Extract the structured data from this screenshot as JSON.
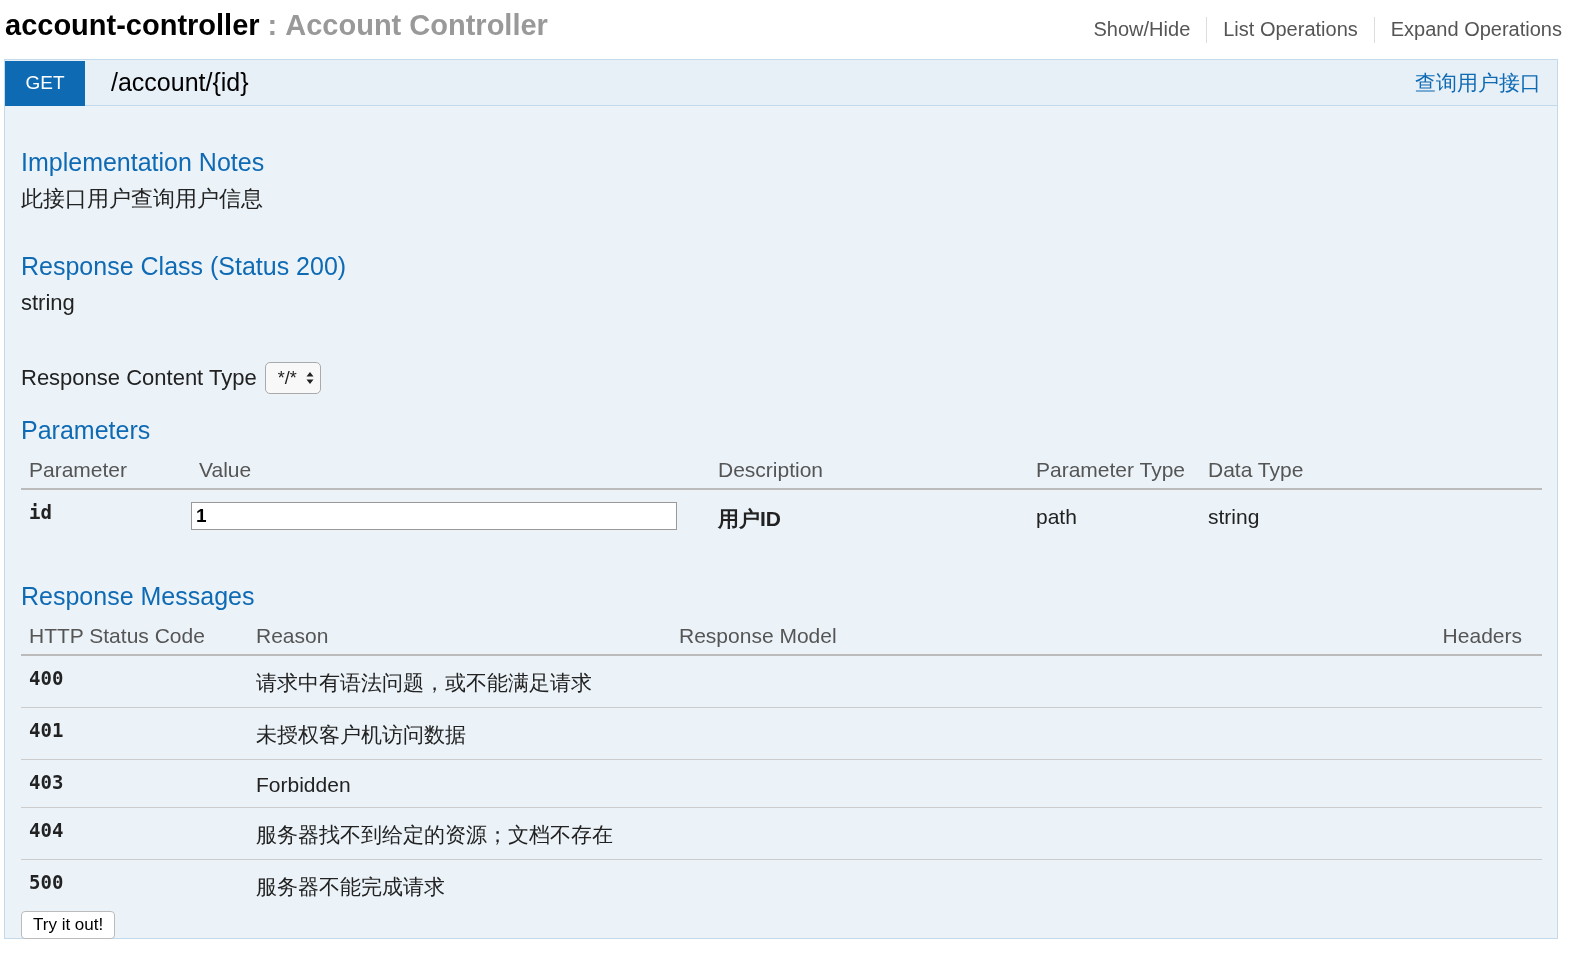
{
  "header": {
    "title": "account-controller",
    "separator": ":",
    "subtitle": "Account Controller",
    "links": [
      "Show/Hide",
      "List Operations",
      "Expand Operations"
    ]
  },
  "operation": {
    "method": "GET",
    "path": "/account/{id}",
    "summary": "查询用户接口",
    "implementation_notes": {
      "heading": "Implementation Notes",
      "text": "此接口用户查询用户信息"
    },
    "response_class": {
      "heading": "Response Class (Status 200)",
      "text": "string"
    },
    "content_type": {
      "label": "Response Content Type",
      "value": "*/*"
    },
    "parameters": {
      "heading": "Parameters",
      "columns": [
        "Parameter",
        "Value",
        "Description",
        "Parameter Type",
        "Data Type"
      ],
      "rows": [
        {
          "name": "id",
          "value": "1",
          "description": "用户ID",
          "parameter_type": "path",
          "data_type": "string"
        }
      ]
    },
    "response_messages": {
      "heading": "Response Messages",
      "columns": [
        "HTTP Status Code",
        "Reason",
        "Response Model",
        "Headers"
      ],
      "rows": [
        {
          "code": "400",
          "reason": "请求中有语法问题，或不能满足请求"
        },
        {
          "code": "401",
          "reason": "未授权客户机访问数据"
        },
        {
          "code": "403",
          "reason": "Forbidden"
        },
        {
          "code": "404",
          "reason": "服务器找不到给定的资源；文档不存在"
        },
        {
          "code": "500",
          "reason": "服务器不能完成请求"
        }
      ]
    },
    "button": "Try it out!"
  }
}
